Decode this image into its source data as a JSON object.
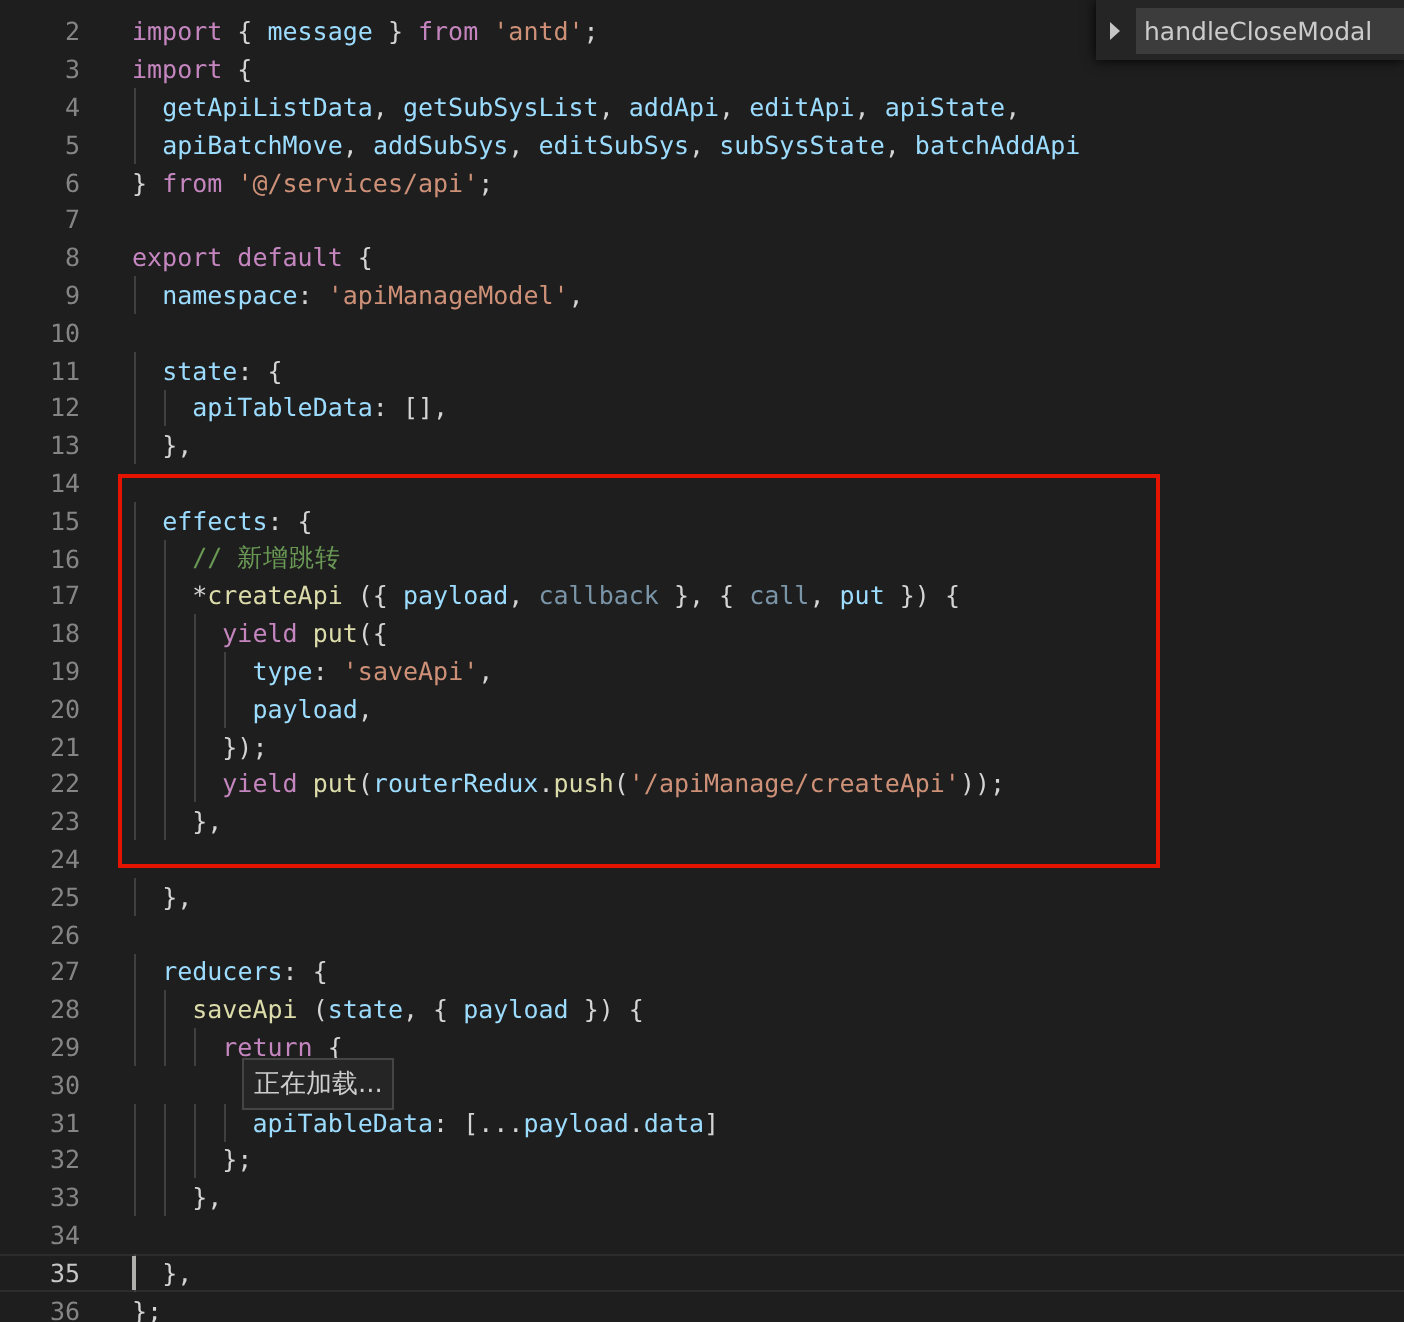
{
  "outline_widget": {
    "label": "handleCloseModal"
  },
  "sections": [
    {
      "framed": false,
      "lines": [
        {
          "n": "2",
          "active": false,
          "tokens": [
            {
              "kind": "kw",
              "t": "import"
            },
            {
              "kind": "p",
              "t": " { "
            },
            {
              "kind": "var",
              "t": "message"
            },
            {
              "kind": "p",
              "t": " } "
            },
            {
              "kind": "kw",
              "t": "from "
            },
            {
              "kind": "str",
              "t": "'antd'"
            },
            {
              "kind": "p",
              "t": ";"
            }
          ]
        },
        {
          "n": "3",
          "active": false,
          "tokens": [
            {
              "kind": "kw",
              "t": "import"
            },
            {
              "kind": "p",
              "t": " {"
            }
          ]
        },
        {
          "n": "4",
          "active": false,
          "tokens": [
            {
              "kind": "var",
              "t": "  getApiListData"
            },
            {
              "kind": "p",
              "t": ", "
            },
            {
              "kind": "var",
              "t": "getSubSysList"
            },
            {
              "kind": "p",
              "t": ", "
            },
            {
              "kind": "var",
              "t": "addApi"
            },
            {
              "kind": "p",
              "t": ", "
            },
            {
              "kind": "var",
              "t": "editApi"
            },
            {
              "kind": "p",
              "t": ", "
            },
            {
              "kind": "var",
              "t": "apiState"
            },
            {
              "kind": "p",
              "t": ","
            }
          ]
        },
        {
          "n": "5",
          "active": false,
          "tokens": [
            {
              "kind": "var",
              "t": "  apiBatchMove"
            },
            {
              "kind": "p",
              "t": ", "
            },
            {
              "kind": "var",
              "t": "addSubSys"
            },
            {
              "kind": "p",
              "t": ", "
            },
            {
              "kind": "var",
              "t": "editSubSys"
            },
            {
              "kind": "p",
              "t": ", "
            },
            {
              "kind": "var",
              "t": "subSysState"
            },
            {
              "kind": "p",
              "t": ", "
            },
            {
              "kind": "var",
              "t": "batchAddApi"
            }
          ]
        },
        {
          "n": "6",
          "active": false,
          "tokens": [
            {
              "kind": "p",
              "t": "} "
            },
            {
              "kind": "kw",
              "t": "from "
            },
            {
              "kind": "str",
              "t": "'@/services/api'"
            },
            {
              "kind": "p",
              "t": ";"
            }
          ]
        },
        {
          "n": "7",
          "active": false
        },
        {
          "n": "8",
          "active": false,
          "tokens": [
            {
              "kind": "kw",
              "t": "export default"
            },
            {
              "kind": "p",
              "t": " {"
            }
          ]
        },
        {
          "n": "9",
          "active": false,
          "tokens": [
            {
              "kind": "var",
              "t": "  namespace"
            },
            {
              "kind": "p",
              "t": ": "
            },
            {
              "kind": "str",
              "t": "'apiManageModel'"
            },
            {
              "kind": "p",
              "t": ","
            }
          ]
        },
        {
          "n": "10",
          "active": false
        },
        {
          "n": "11",
          "active": false,
          "tokens": [
            {
              "kind": "var",
              "t": "  state"
            },
            {
              "kind": "p",
              "t": ": {"
            }
          ]
        },
        {
          "n": "12",
          "active": false,
          "tokens": [
            {
              "kind": "var",
              "t": "    apiTableData"
            },
            {
              "kind": "p",
              "t": ": [],"
            }
          ]
        },
        {
          "n": "13",
          "active": false,
          "tokens": [
            {
              "kind": "p",
              "t": "  },"
            }
          ]
        }
      ]
    },
    {
      "framed": true,
      "lines": [
        {
          "n": "14",
          "active": false
        },
        {
          "n": "15",
          "active": false,
          "tokens": [
            {
              "kind": "var",
              "t": "  effects"
            },
            {
              "kind": "p",
              "t": ": {"
            }
          ]
        },
        {
          "n": "16",
          "active": false,
          "tokens": [
            {
              "kind": "cmt",
              "t": "    // 新增跳转"
            }
          ]
        },
        {
          "n": "17",
          "active": false,
          "tokens": [
            {
              "kind": "p",
              "t": "    *"
            },
            {
              "kind": "fn",
              "t": "createApi"
            },
            {
              "kind": "p",
              "t": " ({ "
            },
            {
              "kind": "var",
              "t": "payload"
            },
            {
              "kind": "p",
              "t": ", "
            },
            {
              "kind": "dim",
              "t": "callback"
            },
            {
              "kind": "p",
              "t": " }, { "
            },
            {
              "kind": "dim",
              "t": "call"
            },
            {
              "kind": "p",
              "t": ", "
            },
            {
              "kind": "var",
              "t": "put"
            },
            {
              "kind": "p",
              "t": " }) {"
            }
          ]
        },
        {
          "n": "18",
          "active": false,
          "tokens": [
            {
              "kind": "kw",
              "t": "      yield "
            },
            {
              "kind": "fn",
              "t": "put"
            },
            {
              "kind": "p",
              "t": "({"
            }
          ]
        },
        {
          "n": "19",
          "active": false,
          "tokens": [
            {
              "kind": "var",
              "t": "        type"
            },
            {
              "kind": "p",
              "t": ": "
            },
            {
              "kind": "str",
              "t": "'saveApi'"
            },
            {
              "kind": "p",
              "t": ","
            }
          ]
        },
        {
          "n": "20",
          "active": false,
          "tokens": [
            {
              "kind": "var",
              "t": "        payload"
            },
            {
              "kind": "p",
              "t": ","
            }
          ]
        },
        {
          "n": "21",
          "active": false,
          "tokens": [
            {
              "kind": "p",
              "t": "      });"
            }
          ]
        },
        {
          "n": "22",
          "active": false,
          "tokens": [
            {
              "kind": "kw",
              "t": "      yield "
            },
            {
              "kind": "fn",
              "t": "put"
            },
            {
              "kind": "p",
              "t": "("
            },
            {
              "kind": "var",
              "t": "routerRedux"
            },
            {
              "kind": "p",
              "t": "."
            },
            {
              "kind": "fn",
              "t": "push"
            },
            {
              "kind": "p",
              "t": "("
            },
            {
              "kind": "str",
              "t": "'/apiManage/createApi'"
            },
            {
              "kind": "p",
              "t": "));"
            }
          ]
        },
        {
          "n": "23",
          "active": false,
          "tokens": [
            {
              "kind": "p",
              "t": "    },"
            }
          ]
        },
        {
          "n": "24",
          "active": false
        }
      ]
    },
    {
      "framed": false,
      "lines": [
        {
          "n": "25",
          "active": false,
          "tokens": [
            {
              "kind": "p",
              "t": "  },"
            }
          ]
        },
        {
          "n": "26",
          "active": false
        },
        {
          "n": "27",
          "active": false,
          "tokens": [
            {
              "kind": "var",
              "t": "  reducers"
            },
            {
              "kind": "p",
              "t": ": {"
            }
          ]
        },
        {
          "n": "28",
          "active": false,
          "tokens": [
            {
              "kind": "fn",
              "t": "    saveApi"
            },
            {
              "kind": "p",
              "t": " ("
            },
            {
              "kind": "var",
              "t": "state"
            },
            {
              "kind": "p",
              "t": ", { "
            },
            {
              "kind": "var",
              "t": "payload"
            },
            {
              "kind": "p",
              "t": " }) {"
            }
          ]
        },
        {
          "n": "29",
          "active": false,
          "tokens": [
            {
              "kind": "kw",
              "t": "      return"
            },
            {
              "kind": "p",
              "t": " {"
            }
          ]
        },
        {
          "n": "30",
          "active": false
        },
        {
          "n": "31",
          "active": false,
          "tokens": [
            {
              "kind": "var",
              "t": "        apiTableData"
            },
            {
              "kind": "p",
              "t": ": [..."
            },
            {
              "kind": "var",
              "t": "payload"
            },
            {
              "kind": "p",
              "t": "."
            },
            {
              "kind": "var",
              "t": "data"
            },
            {
              "kind": "p",
              "t": "]"
            }
          ]
        },
        {
          "n": "32",
          "active": false,
          "tokens": [
            {
              "kind": "p",
              "t": "      };"
            }
          ]
        },
        {
          "n": "33",
          "active": false,
          "tokens": [
            {
              "kind": "p",
              "t": "    },"
            }
          ]
        },
        {
          "n": "34",
          "active": false
        },
        {
          "n": "35",
          "active": true,
          "tokens": [
            {
              "kind": "p",
              "t": "  },"
            }
          ]
        },
        {
          "n": "36",
          "active": false,
          "tokens": [
            {
              "kind": "p",
              "t": "};"
            }
          ]
        }
      ]
    }
  ],
  "hover_tooltip": {
    "text": "正在加载..."
  }
}
